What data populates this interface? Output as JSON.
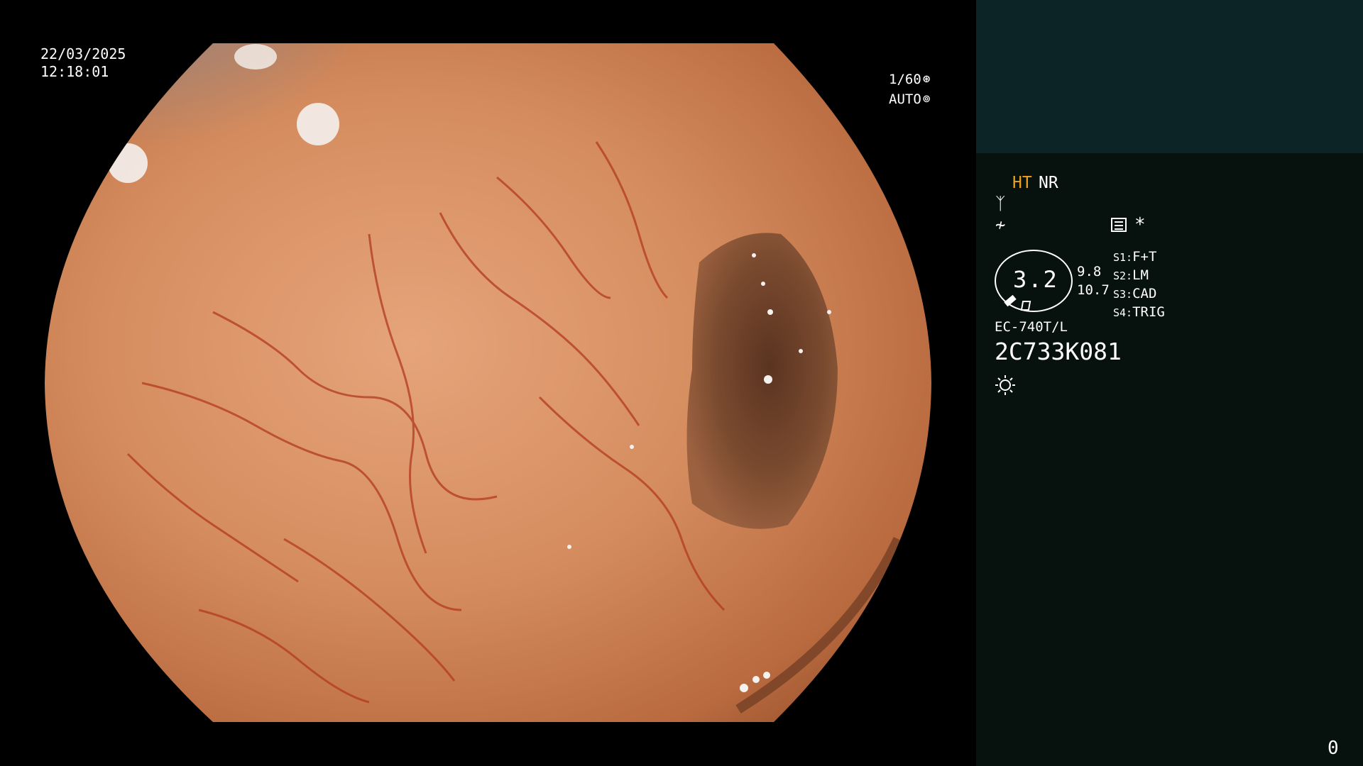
{
  "video": {
    "date": "22/03/2025",
    "time": "12:18:01",
    "shutter": "1/60",
    "shutter_icon": "aperture-icon",
    "iris_mode": "AUTO",
    "iris_icon": "iris-icon"
  },
  "panel": {
    "mode_ht": "HT",
    "mode_nr": "NR",
    "enhancement_icon": "enhancement-icon",
    "color_icon": "color-tone-icon",
    "menu_icon": "menu-icon",
    "star_symbol": "*",
    "zoom_value": "3.2",
    "value_a": "9.8",
    "value_b": "10.7",
    "switches": [
      {
        "key": "S1:",
        "value": "F+T"
      },
      {
        "key": "S2:",
        "value": "LM"
      },
      {
        "key": "S3:",
        "value": "CAD"
      },
      {
        "key": "S4:",
        "value": "TRIG"
      }
    ],
    "scope_model": "EC-740T/L",
    "serial": "2C733K081",
    "light_icon": "light-source-icon",
    "corner_number": "0"
  },
  "colors": {
    "mucosa": "#c97a4e",
    "mucosa_dark": "#8a4a2c",
    "vessels": "#b23a1e",
    "panel_top": "#0d2427",
    "panel_bg": "#07120f",
    "ht_label": "#f0a020"
  }
}
